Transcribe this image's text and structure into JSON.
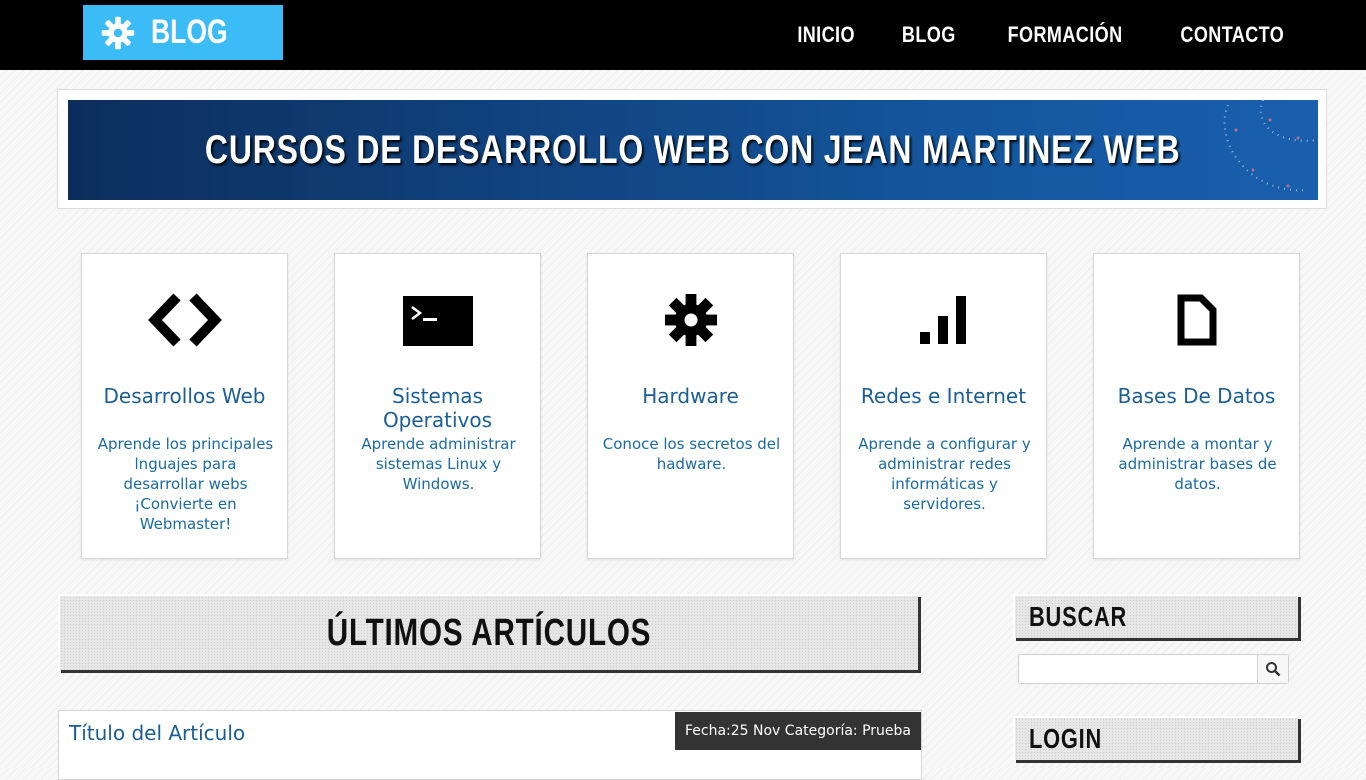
{
  "header": {
    "logo_text": "BLOG",
    "logo_icon": "gear-icon",
    "nav": [
      "INICIO",
      "BLOG",
      "FORMACIÓN",
      "CONTACTO"
    ]
  },
  "banner": {
    "title": "CURSOS DE DESARROLLO WEB CON JEAN MARTINEZ WEB"
  },
  "categories": [
    {
      "icon": "code-icon",
      "title": "Desarrollos Web",
      "description": "Aprende los principales lnguajes para desarrollar webs ¡Convierte en Webmaster!"
    },
    {
      "icon": "terminal-icon",
      "title": "Sistemas Operativos",
      "description": "Aprende administrar sistemas Linux y Windows."
    },
    {
      "icon": "gear-icon",
      "title": "Hardware",
      "description": "Conoce los secretos del hadware."
    },
    {
      "icon": "signal-icon",
      "title": "Redes e Internet",
      "description": "Aprende a configurar y administrar redes informáticas y servidores."
    },
    {
      "icon": "document-icon",
      "title": "Bases De Datos",
      "description": "Aprende a montar y administrar bases de datos."
    }
  ],
  "main": {
    "section_title": "ÚLTIMOS ARTÍCULOS",
    "article": {
      "title": "Título del Artículo",
      "meta": "Fecha:25 Nov Categoría: Prueba"
    }
  },
  "sidebar": {
    "search_title": "BUSCAR",
    "search_value": "",
    "login_title": "LOGIN"
  },
  "colors": {
    "accent": "#3bbcf6",
    "link": "#1b5e93",
    "topbar": "#000000"
  }
}
